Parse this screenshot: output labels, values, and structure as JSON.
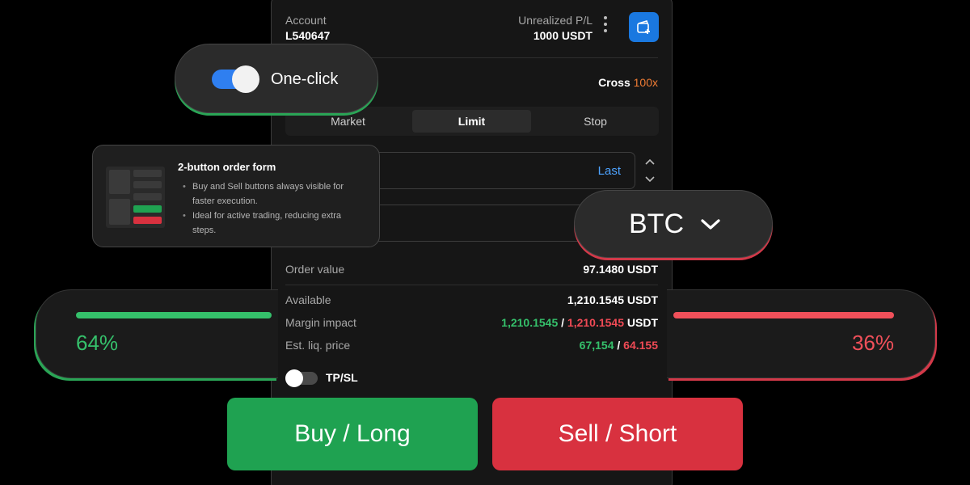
{
  "account": {
    "label": "Account",
    "id": "L540647"
  },
  "unrealized": {
    "label": "Unrealized P/L",
    "value": "1000 USDT"
  },
  "margin_mode": {
    "mode": "Cross",
    "leverage": "100x"
  },
  "order_types": [
    "Market",
    "Limit",
    "Stop"
  ],
  "active_order_type": "Limit",
  "price_field": {
    "reference": "Last"
  },
  "order_value": {
    "label": "Order value",
    "value": "97.1480 USDT"
  },
  "available": {
    "label": "Available",
    "value": "1,210.1545 USDT"
  },
  "margin_impact": {
    "label": "Margin impact",
    "buy": "1,210.1545",
    "sep": " / ",
    "sell": "1,210.1545",
    "unit": " USDT"
  },
  "liq_price": {
    "label": "Est. liq. price",
    "buy": "67,154",
    "sep": " / ",
    "sell": "64.155"
  },
  "tpsl": {
    "label": "TP/SL",
    "enabled": false
  },
  "one_click": {
    "label": "One-click",
    "enabled": true
  },
  "feature_card": {
    "title": "2-button order form",
    "bullets": [
      "Buy and Sell buttons always visible for faster execution.",
      "Ideal for active trading, reducing extra steps."
    ]
  },
  "symbol": {
    "name": "BTC"
  },
  "ratio": {
    "long_pct": "64%",
    "short_pct": "36%",
    "long_value": 64,
    "short_value": 36
  },
  "actions": {
    "buy": "Buy / Long",
    "sell": "Sell / Short"
  },
  "colors": {
    "green": "#35c06b",
    "red": "#f04a55",
    "blue": "#1a78e0",
    "orange": "#f07c34"
  },
  "icons": {
    "wallet": "wallet-add-icon",
    "more": "kebab-menu-icon",
    "symbol_dropdown": "chevron-down-icon",
    "stepper_up": "chevron-up-icon",
    "stepper_down": "chevron-down-icon"
  }
}
